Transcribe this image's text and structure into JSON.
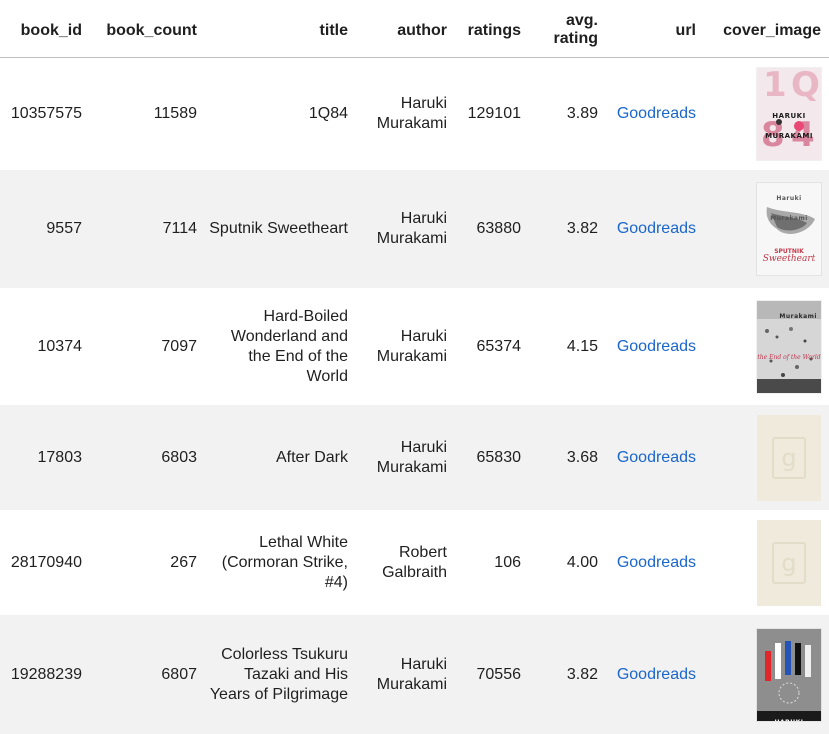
{
  "columns": {
    "book_id": "book_id",
    "book_count": "book_count",
    "title": "title",
    "author": "author",
    "ratings": "ratings",
    "avg_rating_line1": "avg.",
    "avg_rating_line2": "rating",
    "url": "url",
    "cover_image": "cover_image"
  },
  "rows": [
    {
      "book_id": "10357575",
      "book_count": "11589",
      "title": "1Q84",
      "author": "Haruki Murakami",
      "ratings": "129101",
      "avg_rating": "3.89",
      "url": "Goodreads",
      "cover_text": "HARUKI MURAKAMI"
    },
    {
      "book_id": "9557",
      "book_count": "7114",
      "title": "Sputnik Sweetheart",
      "author": "Haruki Murakami",
      "ratings": "63880",
      "avg_rating": "3.82",
      "url": "Goodreads",
      "cover_text": "Haruki Murakami"
    },
    {
      "book_id": "10374",
      "book_count": "7097",
      "title": "Hard-Boiled Wonderland and the End of the World",
      "author": "Haruki Murakami",
      "ratings": "65374",
      "avg_rating": "4.15",
      "url": "Goodreads",
      "cover_text": "Murakami"
    },
    {
      "book_id": "17803",
      "book_count": "6803",
      "title": "After Dark",
      "author": "Haruki Murakami",
      "ratings": "65830",
      "avg_rating": "3.68",
      "url": "Goodreads",
      "cover_text": "g"
    },
    {
      "book_id": "28170940",
      "book_count": "267",
      "title": "Lethal White (Cormoran Strike, #4)",
      "author": "Robert Galbraith",
      "ratings": "106",
      "avg_rating": "4.00",
      "url": "Goodreads",
      "cover_text": "g"
    },
    {
      "book_id": "19288239",
      "book_count": "6807",
      "title": "Colorless Tsukuru Tazaki and His Years of Pilgrimage",
      "author": "Haruki Murakami",
      "ratings": "70556",
      "avg_rating": "3.82",
      "url": "Goodreads",
      "cover_text": "HARUKI MURAKAMI"
    }
  ]
}
